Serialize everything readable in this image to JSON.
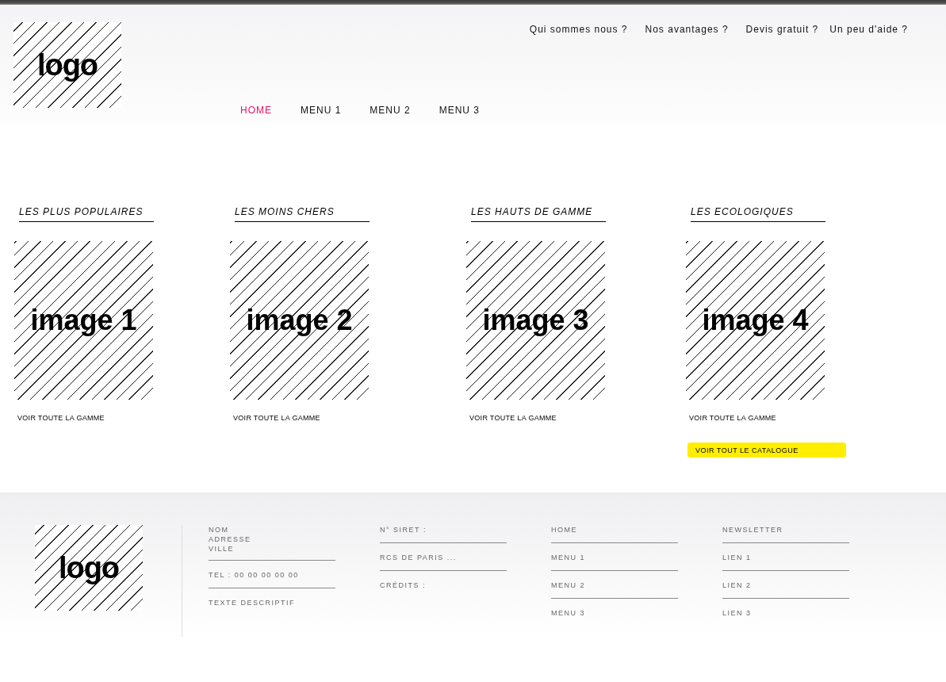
{
  "header": {
    "logo": "logo",
    "top_links": [
      "Qui sommes nous ?",
      "Nos avantages ?",
      "Devis gratuit ?",
      "Un peu d'aide ?"
    ],
    "nav": [
      {
        "label": "HOME",
        "selected": true
      },
      {
        "label": "MENU 1",
        "selected": false
      },
      {
        "label": "MENU 2",
        "selected": false
      },
      {
        "label": "MENU 3",
        "selected": false
      }
    ]
  },
  "categories": [
    {
      "title": "LES PLUS POPULAIRES",
      "image": "image 1",
      "link": "VOIR TOUTE LA GAMME"
    },
    {
      "title": "LES MOINS CHERS",
      "image": "image 2",
      "link": "VOIR TOUTE LA GAMME"
    },
    {
      "title": "LES HAUTS DE GAMME",
      "image": "image 3",
      "link": "VOIR TOUTE LA GAMME"
    },
    {
      "title": "LES ECOLOGIQUES",
      "image": "image 4",
      "link": "VOIR TOUTE LA GAMME"
    }
  ],
  "catalogue_button": "VOIR TOUT LE CATALOGUE",
  "footer": {
    "logo": "logo",
    "columns": [
      [
        [
          "NOM",
          "ADRESSE",
          "VILLE"
        ],
        [
          "TEL : 00 00 00 00 00"
        ],
        [
          "TEXTE DESCRIPTIF"
        ]
      ],
      [
        [
          "N° SIRET :"
        ],
        [
          "RCS DE PARIS ..."
        ],
        [
          "CRÉDITS :"
        ]
      ],
      [
        [
          "HOME"
        ],
        [
          "MENU 1"
        ],
        [
          "MENU 2"
        ],
        [
          "MENU 3"
        ]
      ],
      [
        [
          "NEWSLETTER"
        ],
        [
          "LIEN 1"
        ],
        [
          "LIEN 2"
        ],
        [
          "LIEN 3"
        ]
      ]
    ]
  }
}
